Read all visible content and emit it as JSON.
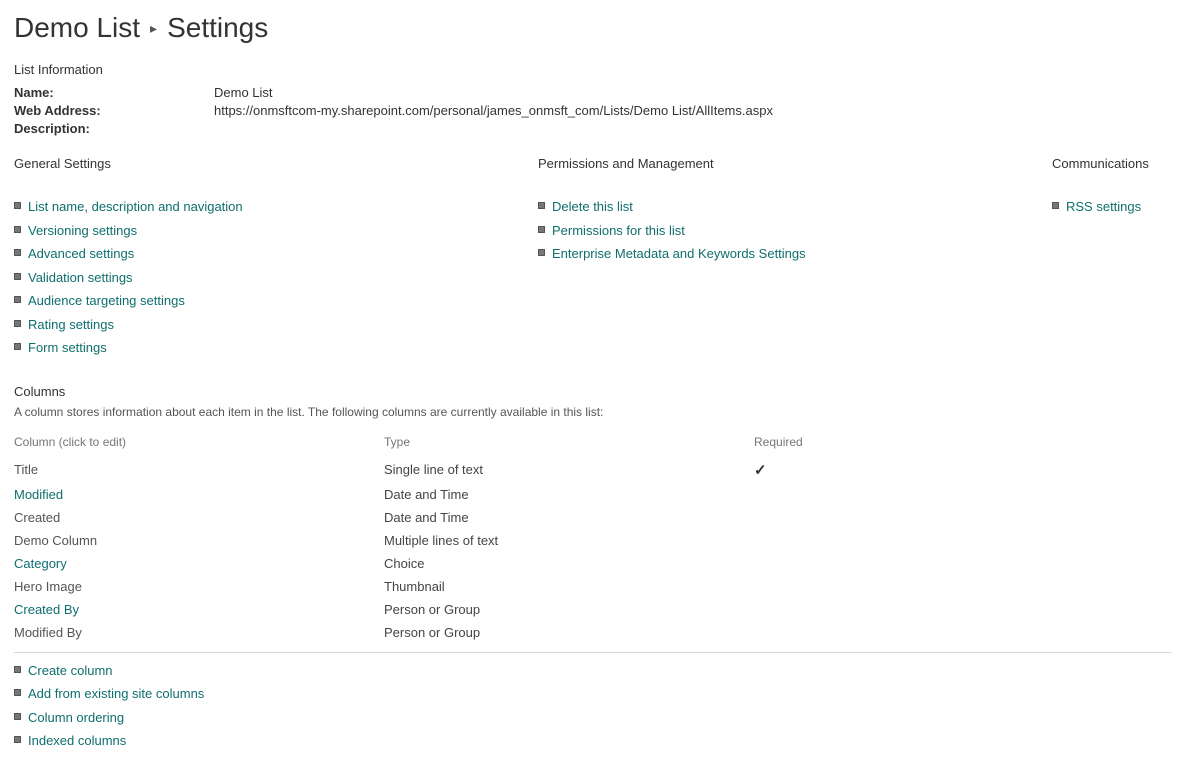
{
  "breadcrumb": {
    "list_name": "Demo List",
    "settings_label": "Settings"
  },
  "list_info": {
    "heading": "List Information",
    "name_label": "Name:",
    "name_value": "Demo List",
    "web_address_label": "Web Address:",
    "web_address_value": "https://onmsftcom-my.sharepoint.com/personal/james_onmsft_com/Lists/Demo List/AllItems.aspx",
    "description_label": "Description:",
    "description_value": ""
  },
  "settings_groups": {
    "general": {
      "heading": "General Settings",
      "links": [
        "List name, description and navigation",
        "Versioning settings",
        "Advanced settings",
        "Validation settings",
        "Audience targeting settings",
        "Rating settings",
        "Form settings"
      ]
    },
    "permissions": {
      "heading": "Permissions and Management",
      "links": [
        "Delete this list",
        "Permissions for this list",
        "Enterprise Metadata and Keywords Settings"
      ]
    },
    "communications": {
      "heading": "Communications",
      "links": [
        "RSS settings"
      ]
    }
  },
  "columns_section": {
    "heading": "Columns",
    "description": "A column stores information about each item in the list. The following columns are currently available in this list:",
    "headers": {
      "name": "Column (click to edit)",
      "type": "Type",
      "required": "Required"
    },
    "rows": [
      {
        "name": "Title",
        "type": "Single line of text",
        "required": true,
        "link": false
      },
      {
        "name": "Modified",
        "type": "Date and Time",
        "required": false,
        "link": true
      },
      {
        "name": "Created",
        "type": "Date and Time",
        "required": false,
        "link": false
      },
      {
        "name": "Demo Column",
        "type": "Multiple lines of text",
        "required": false,
        "link": false
      },
      {
        "name": "Category",
        "type": "Choice",
        "required": false,
        "link": true
      },
      {
        "name": "Hero Image",
        "type": "Thumbnail",
        "required": false,
        "link": false
      },
      {
        "name": "Created By",
        "type": "Person or Group",
        "required": false,
        "link": true
      },
      {
        "name": "Modified By",
        "type": "Person or Group",
        "required": false,
        "link": false
      }
    ],
    "actions": [
      "Create column",
      "Add from existing site columns",
      "Column ordering",
      "Indexed columns"
    ]
  }
}
